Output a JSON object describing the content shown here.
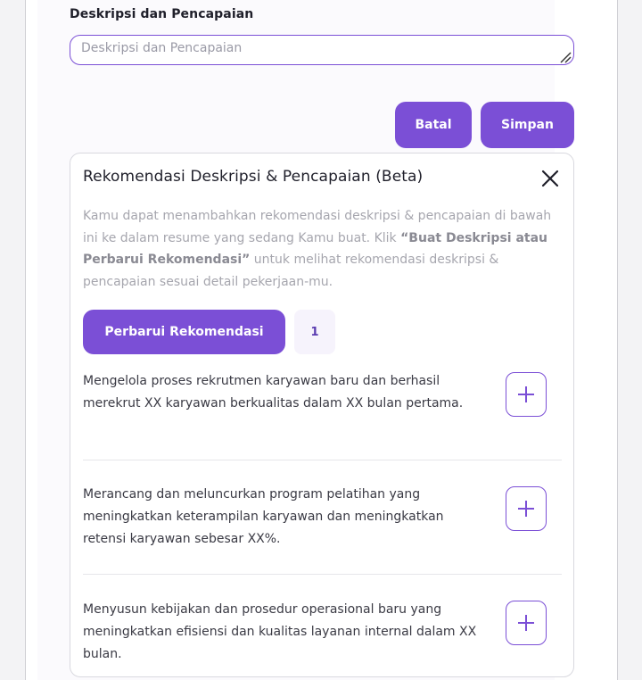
{
  "form": {
    "field_label": "Deskripsi dan Pencapaian",
    "input_value": "",
    "input_placeholder": "Deskripsi dan Pencapaian",
    "cancel_label": "Batal",
    "save_label": "Simpan"
  },
  "recommendation": {
    "title": "Rekomendasi Deskripsi & Pencapaian (Beta)",
    "intro_before": "Kamu dapat menambahkan rekomendasi deskripsi & pencapaian di bawah ini ke dalam resume yang sedang Kamu buat. Klik ",
    "intro_bold": "“Buat Deskripsi atau Perbarui Rekomendasi”",
    "intro_after": " untuk melihat rekomendasi deskripsi & pencapaian sesuai detail pekerjaan-mu.",
    "refresh_label": "Perbarui Rekomendasi",
    "counter": "1",
    "items": [
      {
        "text": "Mengelola proses rekrutmen karyawan baru dan berhasil merekrut XX karyawan berkualitas dalam XX bulan pertama."
      },
      {
        "text": "Merancang dan meluncurkan program pelatihan yang meningkatkan keterampilan karyawan dan meningkatkan retensi karyawan sebesar XX%."
      },
      {
        "text": "Menyusun kebijakan dan prosedur operasional baru yang meningkatkan efisiensi dan kualitas layanan internal dalam XX bulan."
      }
    ]
  },
  "colors": {
    "accent": "#7b4fd6",
    "text": "#1f1f2a",
    "muted": "#a6a6ae"
  },
  "icons": {
    "close": "close-icon",
    "add": "plus-icon",
    "resize": "resize-grip-icon"
  }
}
